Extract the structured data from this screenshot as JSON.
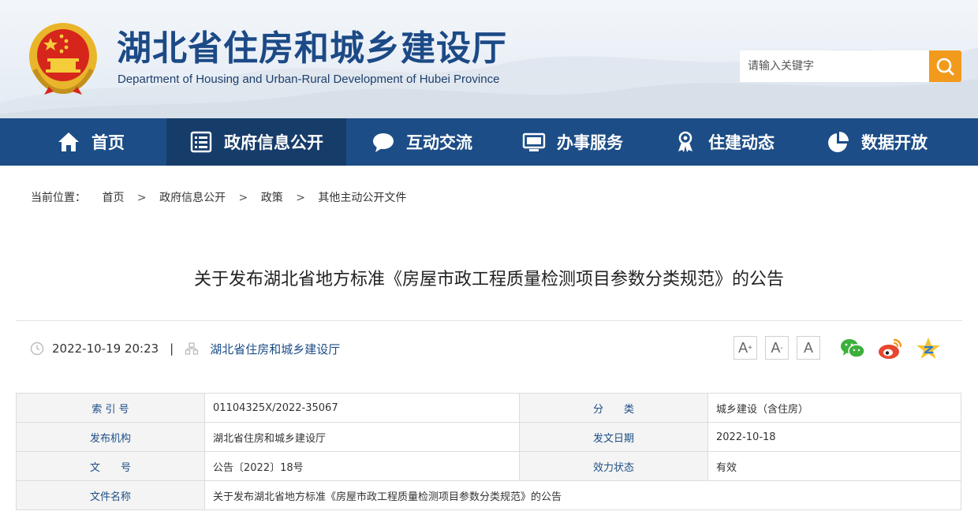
{
  "header": {
    "title": "湖北省住房和城乡建设厅",
    "subtitle": "Department of Housing and Urban-Rural Development of Hubei Province"
  },
  "search": {
    "placeholder": "请输入关键字",
    "icon": "search-icon"
  },
  "nav": {
    "items": [
      {
        "label": "首页",
        "icon": "home-icon"
      },
      {
        "label": "政府信息公开",
        "icon": "document-list-icon",
        "active": true
      },
      {
        "label": "互动交流",
        "icon": "chat-bubble-icon"
      },
      {
        "label": "办事服务",
        "icon": "monitor-icon"
      },
      {
        "label": "住建动态",
        "icon": "badge-icon"
      },
      {
        "label": "数据开放",
        "icon": "pie-chart-icon"
      }
    ]
  },
  "breadcrumb": {
    "prefix": "当前位置：",
    "items": [
      "首页",
      "政府信息公开",
      "政策",
      "其他主动公开文件"
    ],
    "separator": ">"
  },
  "article": {
    "title": "关于发布湖北省地方标准《房屋市政工程质量检测项目参数分类规范》的公告",
    "datetime": "2022-10-19 20:23",
    "divider": "|",
    "source": "湖北省住房和城乡建设厅"
  },
  "font_controls": [
    "A",
    "A",
    "A"
  ],
  "share": [
    "wechat-icon",
    "weibo-icon",
    "qzone-icon"
  ],
  "info_table": {
    "rows": [
      [
        "索 引 号",
        "01104325X/2022-35067",
        "分　　类",
        "城乡建设（含住房）"
      ],
      [
        "发布机构",
        "湖北省住房和城乡建设厅",
        "发文日期",
        "2022-10-18"
      ],
      [
        "文　　号",
        "公告〔2022〕18号",
        "效力状态",
        "有效"
      ],
      [
        "文件名称",
        "关于发布湖北省地方标准《房屋市政工程质量检测项目参数分类规范》的公告"
      ]
    ]
  },
  "colors": {
    "nav_bg": "#1c4d86",
    "nav_active": "#163c6a",
    "accent": "#f29a1c",
    "link": "#1c4d86"
  }
}
